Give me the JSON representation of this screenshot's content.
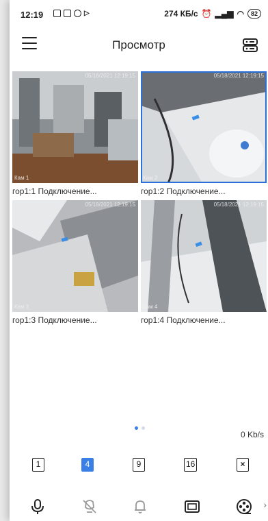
{
  "status": {
    "time": "12:19",
    "speed": "274 КБ/с",
    "battery": "82"
  },
  "header": {
    "title": "Просмотр"
  },
  "cameras": [
    {
      "timestamp": "05/18/2021 12:19:15",
      "cam_label": "Кам 1",
      "caption": "гор1:1  Подключение..."
    },
    {
      "timestamp": "05/18/2021 12:19:15",
      "cam_label": "Кам 2",
      "caption": "гор1:2  Подключение..."
    },
    {
      "timestamp": "05/18/2021 12:19:15",
      "cam_label": "Кам 3",
      "caption": "гор1:3  Подключение..."
    },
    {
      "timestamp": "05/18/2021 12:19:15",
      "cam_label": "Кам 4",
      "caption": "гор1:4  Подключение..."
    }
  ],
  "selected_camera": 2,
  "pager": {
    "pages": 2,
    "current": 1
  },
  "bitrate": "0 Kb/s",
  "split": {
    "options": [
      "1",
      "4",
      "9",
      "16"
    ],
    "active": "4"
  },
  "toolbar": {
    "icons": [
      "microphone-icon",
      "ptz-off-icon",
      "bell-icon",
      "fullscreen-icon",
      "record-reel-icon"
    ]
  },
  "colors": {
    "accent": "#3a7fe6",
    "selection": "#2b6fd9"
  }
}
